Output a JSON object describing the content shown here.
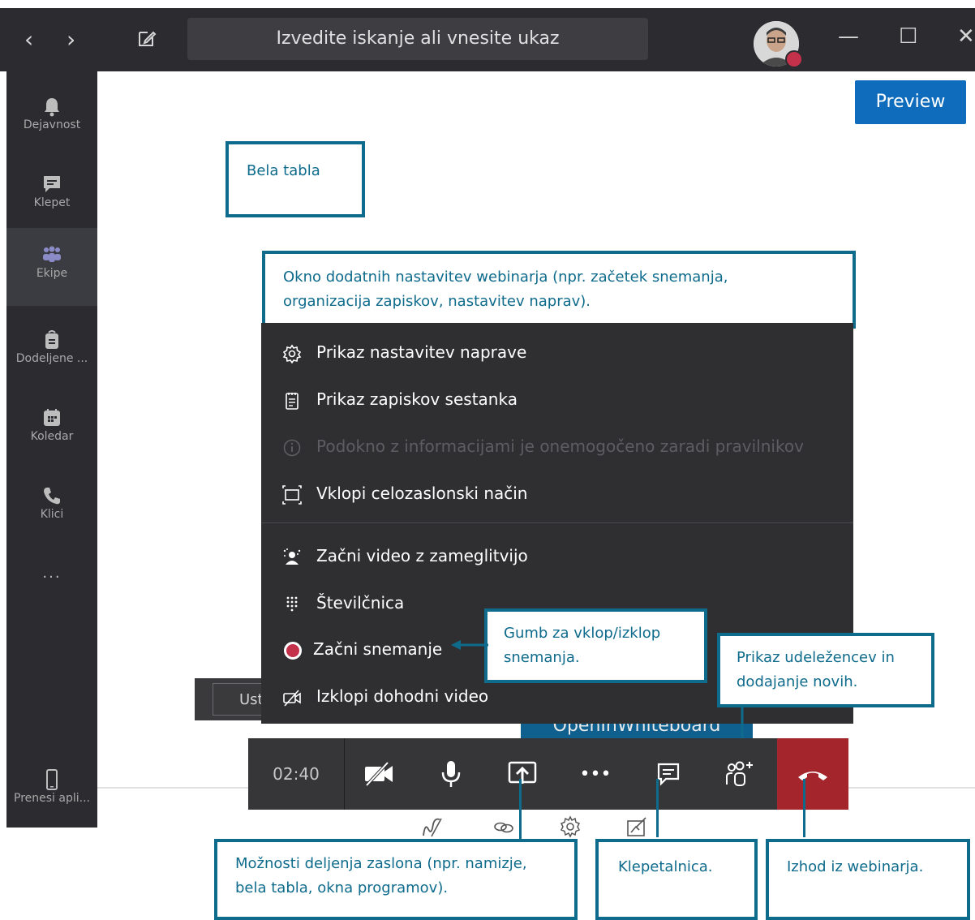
{
  "titlebar": {
    "nav_back": "‹",
    "nav_forward": "›",
    "search_placeholder": "Izvedite iskanje ali vnesite ukaz",
    "minimize": "—",
    "maximize": "☐",
    "close": "✕"
  },
  "rail": {
    "items": [
      {
        "label": "Dejavnost",
        "icon": "bell-icon"
      },
      {
        "label": "Klepet",
        "icon": "chat-icon"
      },
      {
        "label": "Ekipe",
        "icon": "teams-icon"
      },
      {
        "label": "Dodeljene ...",
        "icon": "assignments-icon"
      },
      {
        "label": "Koledar",
        "icon": "calendar-icon"
      },
      {
        "label": "Klici",
        "icon": "phone-icon"
      }
    ],
    "more": "...",
    "bottom_label": "Prenesi apli..."
  },
  "preview_label": "Preview",
  "callouts": {
    "whiteboard": "Bela tabla",
    "more_options_line1": "Okno dodatnih nastavitev webinarja (npr. začetek snemanja,",
    "more_options_line2": "organizacija zapiskov, nastavitev naprav).",
    "record_line1": "Gumb za vklop/izklop",
    "record_line2": "snemanja.",
    "participants_line1": "Prikaz udeležencev in",
    "participants_line2": "dodajanje novih.",
    "share_line1": "Možnosti deljenja zaslona (npr. namizje,",
    "share_line2": "bela tabla, okna programov).",
    "chat": "Klepetalnica.",
    "leave": "Izhod iz webinarja."
  },
  "menu": {
    "device_settings": "Prikaz nastavitev naprave",
    "meeting_notes": "Prikaz zapiskov sestanka",
    "info_disabled": "Podokno z informacijami je onemogočeno zaradi pravilnikov",
    "fullscreen": "Vklopi celozaslonski način",
    "blur_video": "Začni video z zameglitvijo",
    "dialpad": "Številčnica",
    "start_recording": "Začni snemanje",
    "incoming_video_off": "Izklopi dohodni video"
  },
  "behind": {
    "button_fragment": "Ust",
    "open_whiteboard": "OpenInWhiteboard"
  },
  "callbar": {
    "timer": "02:40",
    "more": "•••"
  },
  "colors": {
    "accent": "#0f6cbd",
    "callout_border": "#0e6b8c",
    "hangup": "#a4262c",
    "record": "#c4314b"
  }
}
